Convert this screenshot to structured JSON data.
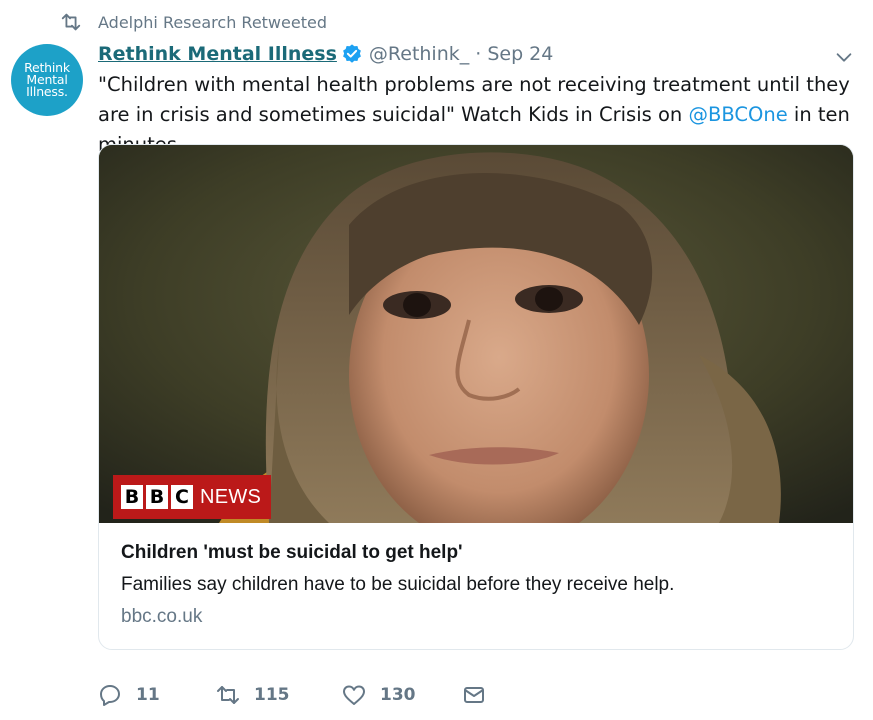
{
  "retweet_context": {
    "label": "Adelphi Research Retweeted",
    "icon": "retweet-icon"
  },
  "avatar": {
    "lines": [
      "Rethink",
      "Mental",
      "Illness."
    ],
    "color": "#1da1c8"
  },
  "author": {
    "name": "Rethink Mental Illness",
    "handle": "@Rethink_",
    "separator": "·",
    "date": "Sep 24",
    "verified_icon": "verified-badge-icon",
    "name_color": "#1b6a78"
  },
  "tweet": {
    "text_before": "\"Children with mental health problems are not receiving treatment until they are in crisis and sometimes suicidal\" Watch Kids in Crisis on ",
    "mention": "@BBCOne",
    "text_after": " in ten minutes.",
    "link_color": "#1b95e0"
  },
  "card": {
    "logo": {
      "letters": [
        "B",
        "B",
        "C"
      ],
      "word": "NEWS",
      "color": "#bb1919"
    },
    "title": "Children 'must be suicidal to get help'",
    "description": "Families say children have to be suicidal before they receive help.",
    "domain": "bbc.co.uk"
  },
  "actions": {
    "reply": {
      "icon": "reply-icon",
      "count": "11"
    },
    "retweet": {
      "icon": "retweet-icon",
      "count": "115"
    },
    "like": {
      "icon": "heart-icon",
      "count": "130"
    },
    "message": {
      "icon": "envelope-icon"
    }
  },
  "menu": {
    "icon": "chevron-down-icon"
  }
}
